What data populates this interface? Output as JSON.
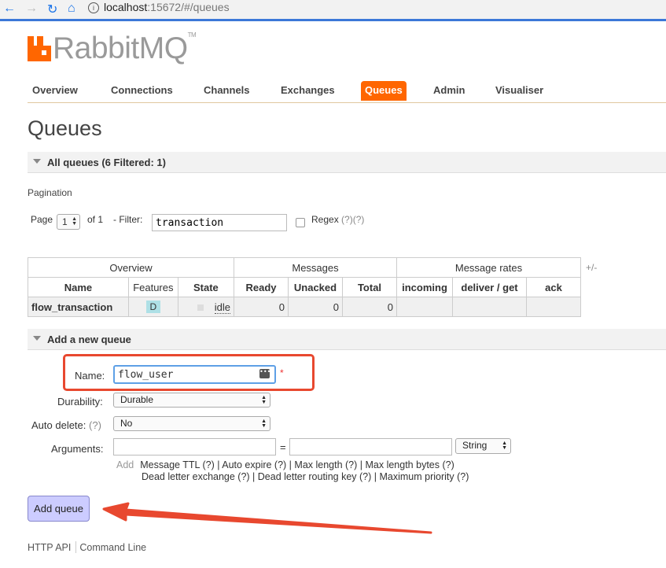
{
  "browser": {
    "host": "localhost",
    "rest": ":15672/#/queues"
  },
  "logo": {
    "text": "RabbitMQ",
    "tm": "TM"
  },
  "nav": {
    "tabs": [
      "Overview",
      "Connections",
      "Channels",
      "Exchanges",
      "Queues",
      "Admin",
      "Visualiser"
    ],
    "active": "Queues"
  },
  "page_title": "Queues",
  "all_queues": {
    "header": "All queues (6 Filtered: 1)"
  },
  "pagination": {
    "title": "Pagination",
    "page_label": "Page",
    "page_value": "1",
    "of_label": "of 1",
    "filter_label": "- Filter:",
    "filter_value": "transaction",
    "regex_label": "Regex",
    "regex_hints": "(?)(?)"
  },
  "table": {
    "groups": {
      "overview": "Overview",
      "messages": "Messages",
      "rates": "Message rates",
      "toggle": "+/-"
    },
    "columns": [
      "Name",
      "Features",
      "State",
      "Ready",
      "Unacked",
      "Total",
      "incoming",
      "deliver / get",
      "ack"
    ],
    "row": {
      "name": "flow_transaction",
      "feature": "D",
      "state": "idle",
      "ready": "0",
      "unacked": "0",
      "total": "0"
    }
  },
  "add_queue": {
    "header": "Add a new queue",
    "name_label": "Name:",
    "name_value": "flow_user",
    "required": "*",
    "durability_label": "Durability:",
    "durability_value": "Durable",
    "autodelete_label": "Auto delete:",
    "autodelete_hint": "(?)",
    "autodelete_value": "No",
    "arguments_label": "Arguments:",
    "equals": "=",
    "arg_type": "String",
    "add_label": "Add",
    "hints_line1": "Message TTL (?) | Auto expire (?) | Max length (?) | Max length bytes (?)",
    "hints_line2": "Dead letter exchange (?) | Dead letter routing key (?) | Maximum priority (?)",
    "button": "Add queue"
  },
  "footer": {
    "http_api": "HTTP API",
    "cli": "Command Line"
  },
  "colors": {
    "accent": "#ff6600",
    "annotation": "#e8482f",
    "button": "#ccccff"
  }
}
